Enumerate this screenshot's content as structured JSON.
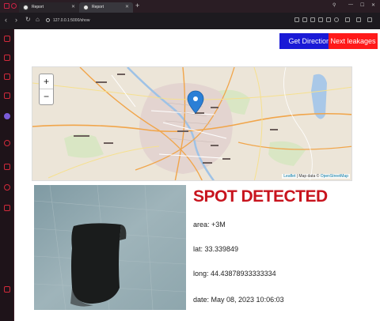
{
  "browser": {
    "tabs": [
      {
        "title": "Report"
      },
      {
        "title": "Report"
      }
    ],
    "new_tab": "+",
    "url": "127.0.0.1:5000/show"
  },
  "actions": {
    "directions_label": "Get Directions",
    "next_label": "Next leakages"
  },
  "map": {
    "zoom_in": "+",
    "zoom_out": "−",
    "attribution_leaflet": "Leaflet",
    "attribution_sep": " | Map data © ",
    "attribution_osm": "OpenStreetMap",
    "pin_color": "#2b7fd6"
  },
  "spot": {
    "title": "SPOT DETECTED",
    "area": "area: +3M",
    "lat": "lat: 33.339849",
    "long": "long: 44.43878933333334",
    "date": "date: May 08, 2023 10:06:03"
  },
  "colors": {
    "title_red": "#c8141e",
    "directions_bg": "#1a1ad6",
    "next_bg": "#ff1a1a",
    "browser_accent": "#d12a3b"
  }
}
